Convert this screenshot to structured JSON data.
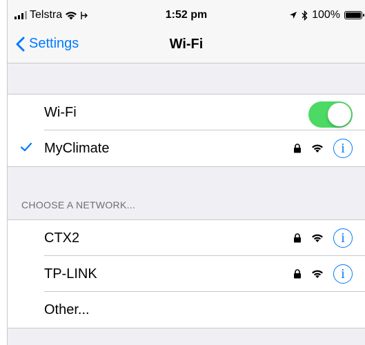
{
  "status_bar": {
    "carrier": "Telstra",
    "time": "1:52 pm",
    "battery": "100%"
  },
  "nav": {
    "back_label": "Settings",
    "title": "Wi-Fi"
  },
  "wifi_toggle": {
    "label": "Wi-Fi",
    "on": true
  },
  "connected_network": {
    "name": "MyClimate",
    "secured": true
  },
  "section_header": "CHOOSE A NETWORK...",
  "networks": [
    {
      "name": "CTX2",
      "secured": true
    },
    {
      "name": "TP-LINK",
      "secured": true
    }
  ],
  "other_label": "Other...",
  "colors": {
    "accent": "#007aff",
    "toggle_on": "#4cd964",
    "background": "#efeff4"
  },
  "icons": {
    "info": "i"
  }
}
